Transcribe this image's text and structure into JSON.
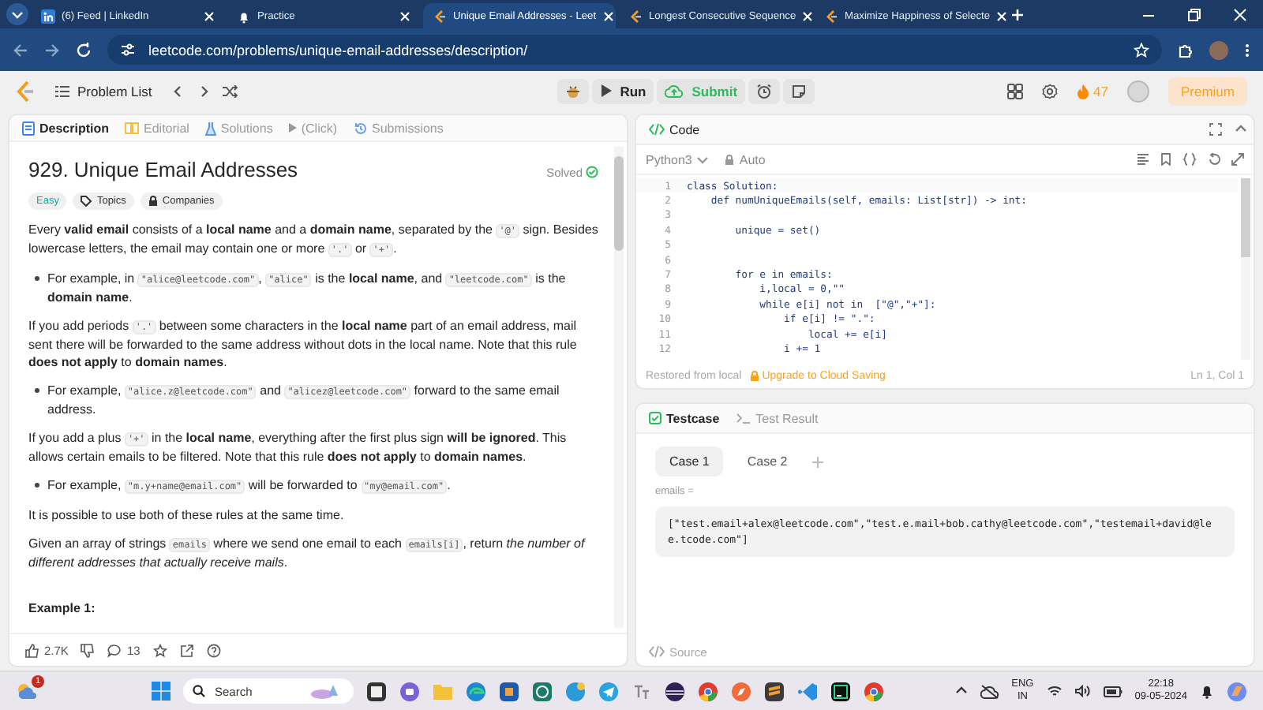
{
  "browser": {
    "tabs": [
      {
        "kind": "linkedin",
        "title": "(6) Feed | LinkedIn",
        "selected": false
      },
      {
        "kind": "bell",
        "title": "Practice",
        "selected": false
      },
      {
        "kind": "leetcode",
        "title": "Unique Email Addresses - Leet",
        "selected": true
      },
      {
        "kind": "leetcode",
        "title": "Longest Consecutive Sequence",
        "selected": false
      },
      {
        "kind": "leetcode",
        "title": "Maximize Happiness of Selecte",
        "selected": false
      }
    ],
    "url": "leetcode.com/problems/unique-email-addresses/description/"
  },
  "toolbar": {
    "problem_list": "Problem List",
    "run": "Run",
    "submit": "Submit",
    "streak": "47",
    "premium": "Premium"
  },
  "description": {
    "tabs": [
      {
        "kind": "doc",
        "label": "Description",
        "selected": true
      },
      {
        "kind": "book",
        "label": "Editorial",
        "selected": false
      },
      {
        "kind": "flask",
        "label": "Solutions",
        "selected": false
      },
      {
        "kind": "history",
        "label": "Submissions",
        "selected": false
      }
    ],
    "solutions_hint": "(Click)",
    "title": "929. Unique Email Addresses",
    "status": "Solved",
    "difficulty": "Easy",
    "tags": [
      "Topics",
      "Companies"
    ],
    "content": [
      {
        "kind": "paragraph",
        "parts": [
          {
            "kind": "text",
            "text": "Every **valid email** consists of a **local name** and a **domain name**, separated by the "
          },
          {
            "kind": "code",
            "text": "'@'"
          },
          {
            "kind": "text",
            "text": " sign. Besides lowercase letters, the email may contain one or more "
          },
          {
            "kind": "code",
            "text": "'.'"
          },
          {
            "kind": "text",
            "text": " or "
          },
          {
            "kind": "code",
            "text": "'+'"
          },
          {
            "kind": "text",
            "text": "."
          }
        ]
      },
      {
        "kind": "bullet",
        "parts": [
          {
            "kind": "text",
            "text": "For example, in "
          },
          {
            "kind": "code",
            "text": "\"alice@leetcode.com\""
          },
          {
            "kind": "text",
            "text": ", "
          },
          {
            "kind": "code",
            "text": "\"alice\""
          },
          {
            "kind": "text",
            "text": " is the **local name**, and "
          },
          {
            "kind": "code",
            "text": "\"leetcode.com\""
          },
          {
            "kind": "text",
            "text": " is the **domain name**."
          }
        ]
      },
      {
        "kind": "paragraph",
        "parts": [
          {
            "kind": "text",
            "text": "If you add periods "
          },
          {
            "kind": "code",
            "text": "'.'"
          },
          {
            "kind": "text",
            "text": " between some characters in the **local name** part of an email address, mail sent there will be forwarded to the same address without dots in the local name. Note that this rule **does not apply** to **domain names**."
          }
        ]
      },
      {
        "kind": "bullet",
        "parts": [
          {
            "kind": "text",
            "text": "For example, "
          },
          {
            "kind": "code",
            "text": "\"alice.z@leetcode.com\""
          },
          {
            "kind": "text",
            "text": " and "
          },
          {
            "kind": "code",
            "text": "\"alicez@leetcode.com\""
          },
          {
            "kind": "text",
            "text": " forward to the same email address."
          }
        ]
      },
      {
        "kind": "paragraph",
        "parts": [
          {
            "kind": "text",
            "text": "If you add a plus "
          },
          {
            "kind": "code",
            "text": "'+'"
          },
          {
            "kind": "text",
            "text": " in the **local name**, everything after the first plus sign **will be ignored**. This allows certain emails to be filtered. Note that this rule **does not apply** to **domain names**."
          }
        ]
      },
      {
        "kind": "bullet",
        "parts": [
          {
            "kind": "text",
            "text": "For example, "
          },
          {
            "kind": "code",
            "text": "\"m.y+name@email.com\""
          },
          {
            "kind": "text",
            "text": " will be forwarded to "
          },
          {
            "kind": "code",
            "text": "\"my@email.com\""
          },
          {
            "kind": "text",
            "text": "."
          }
        ]
      },
      {
        "kind": "paragraph",
        "parts": [
          {
            "kind": "text",
            "text": "It is possible to use both of these rules at the same time."
          }
        ]
      },
      {
        "kind": "paragraph",
        "parts": [
          {
            "kind": "text",
            "text": "Given an array of strings "
          },
          {
            "kind": "code",
            "text": "emails"
          },
          {
            "kind": "text",
            "text": " where we send one email to each "
          },
          {
            "kind": "code",
            "text": "emails[i]"
          },
          {
            "kind": "text",
            "text": ", return *the number of different addresses that actually receive mails*."
          }
        ]
      },
      {
        "kind": "heading",
        "parts": [
          {
            "kind": "text",
            "text": "Example 1:"
          }
        ]
      }
    ],
    "likes": "2.7K",
    "comments": "13"
  },
  "editor": {
    "title": "Code",
    "language": "Python3",
    "mode": "Auto",
    "lines": [
      {
        "number": "1",
        "code": "class Solution:"
      },
      {
        "number": "2",
        "code": "    def numUniqueEmails(self, emails: List[str]) -> int:"
      },
      {
        "number": "3"
      },
      {
        "number": "4",
        "code": "        unique = set()"
      },
      {
        "number": "5"
      },
      {
        "number": "6"
      },
      {
        "number": "7",
        "code": "        for e in emails:"
      },
      {
        "number": "8",
        "code": "            i,local = 0,\"\""
      },
      {
        "number": "9",
        "code": "            while e[i] not in  [\"@\",\"+\"]:"
      },
      {
        "number": "10",
        "code": "                if e[i] != \".\":"
      },
      {
        "number": "11",
        "code": "                    local += e[i]"
      },
      {
        "number": "12",
        "code": "                i += 1"
      }
    ],
    "status": "Restored from local",
    "upgrade": "Upgrade to Cloud Saving",
    "cursor": "Ln 1, Col 1"
  },
  "testcase": {
    "tabs": [
      {
        "kind": "check",
        "label": "Testcase",
        "selected": true
      },
      {
        "kind": "terminal",
        "label": "Test Result",
        "selected": false
      }
    ],
    "cases": [
      {
        "label": "Case 1",
        "selected": true
      },
      {
        "label": "Case 2",
        "selected": false
      }
    ],
    "param": "emails =",
    "value": "[\"test.email+alex@leetcode.com\",\"test.e.mail+bob.cathy@leetcode.com\",\"testemail+david@lee.tcode.com\"]",
    "source": "Source"
  },
  "taskbar": {
    "notification_count": "1",
    "search": "Search",
    "language": "ENG",
    "region": "IN",
    "time": "22:18",
    "date": "09-05-2024"
  }
}
